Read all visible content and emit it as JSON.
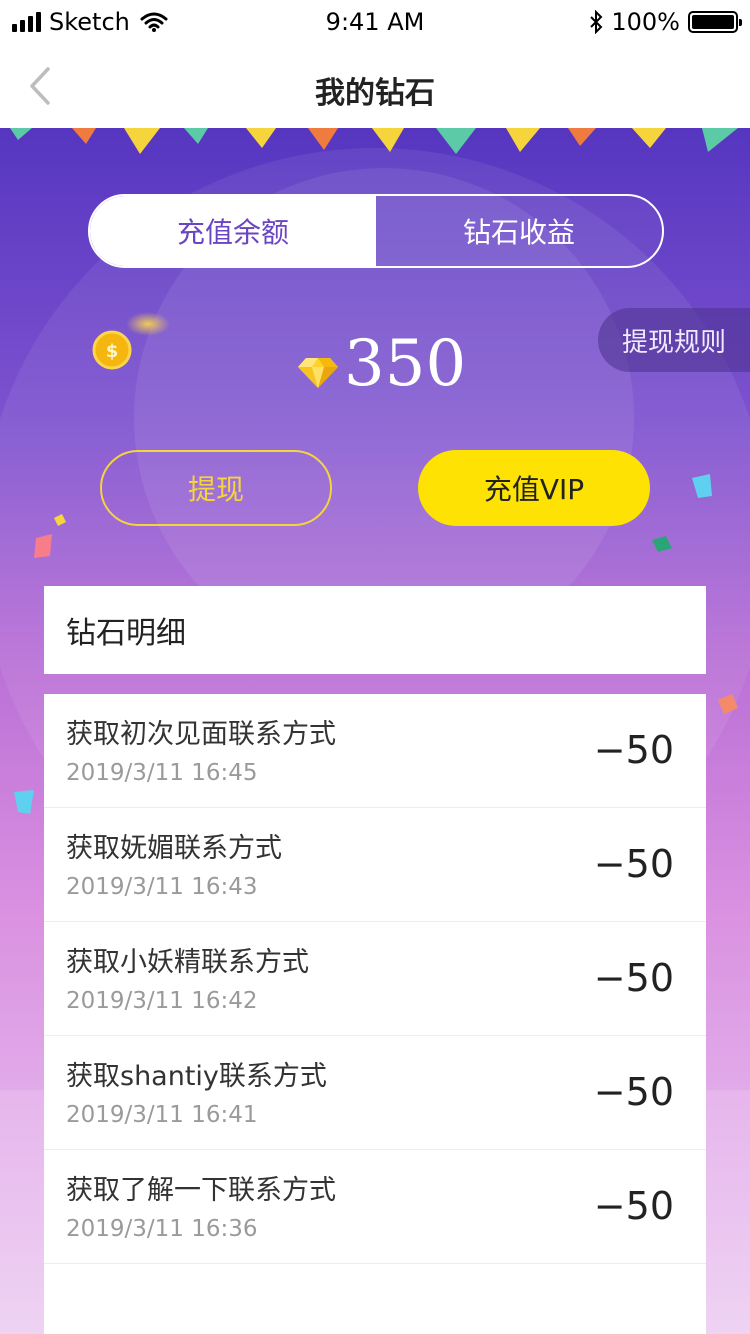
{
  "status_bar": {
    "carrier": "Sketch",
    "time": "9:41 AM",
    "battery": "100%"
  },
  "nav": {
    "title": "我的钻石"
  },
  "tabs": [
    {
      "label": "充值余额",
      "active": true
    },
    {
      "label": "钻石收益",
      "active": false
    }
  ],
  "rules_label": "提现规则",
  "balance": "350",
  "buttons": {
    "withdraw": "提现",
    "vip": "充值VIP"
  },
  "detail": {
    "title": "钻石明细",
    "items": [
      {
        "title": "获取初次见面联系方式",
        "time": "2019/3/11 16:45",
        "amount": "−50"
      },
      {
        "title": "获取妩媚联系方式",
        "time": "2019/3/11 16:43",
        "amount": "−50"
      },
      {
        "title": "获取小妖精联系方式",
        "time": "2019/3/11 16:42",
        "amount": "−50"
      },
      {
        "title": "获取shantiy联系方式",
        "time": "2019/3/11 16:41",
        "amount": "−50"
      },
      {
        "title": "获取了解一下联系方式",
        "time": "2019/3/11 16:36",
        "amount": "−50"
      }
    ]
  },
  "colors": {
    "accent": "#6a45c2",
    "vip_yellow": "#fde203",
    "withdraw_border": "#f6d43c"
  },
  "icons": {
    "back": "chevron-left-icon",
    "coin": "coin-icon",
    "diamond": "diamond-icon"
  }
}
